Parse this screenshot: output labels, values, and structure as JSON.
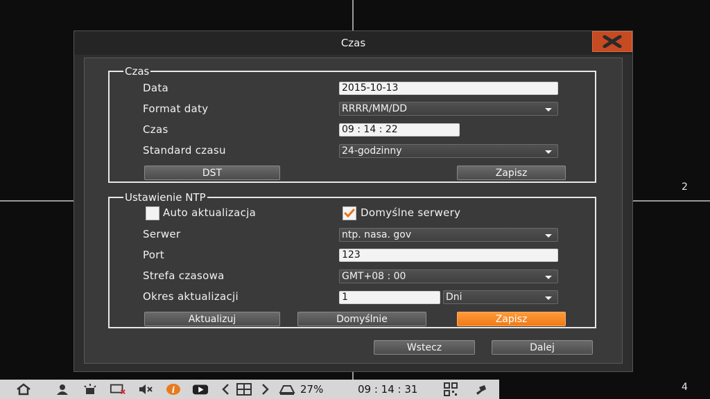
{
  "background": {
    "channels": [
      "2",
      "4"
    ]
  },
  "dialog": {
    "title": "Czas",
    "czas_group": {
      "legend": "Czas",
      "rows": {
        "data_label": "Data",
        "data_value": "2015-10-13",
        "format_label": "Format daty",
        "format_value": "RRRR/MM/DD",
        "czas_label": "Czas",
        "czas_value": "09 : 14 : 22",
        "standard_label": "Standard czasu",
        "standard_value": "24-godzinny"
      },
      "dst_button": "DST",
      "save_button": "Zapisz"
    },
    "ntp_group": {
      "legend": "Ustawienie NTP",
      "auto_update_label": "Auto aktualizacja",
      "auto_update_checked": false,
      "default_servers_label": "Domyślne serwery",
      "default_servers_checked": true,
      "server_label": "Serwer",
      "server_value": "ntp. nasa. gov",
      "port_label": "Port",
      "port_value": "123",
      "timezone_label": "Strefa czasowa",
      "timezone_value": "GMT+08 : 00",
      "period_label": "Okres aktualizacji",
      "period_value": "1",
      "period_unit": "Dni",
      "update_button": "Aktualizuj",
      "defaults_button": "Domyślnie",
      "save_button": "Zapisz"
    },
    "back_button": "Wstecz",
    "next_button": "Dalej"
  },
  "taskbar": {
    "hdd_percent": "27%",
    "clock": "09 : 14 : 31"
  },
  "colors": {
    "accent_orange": "#f07a18",
    "close_red": "#c64a22"
  }
}
